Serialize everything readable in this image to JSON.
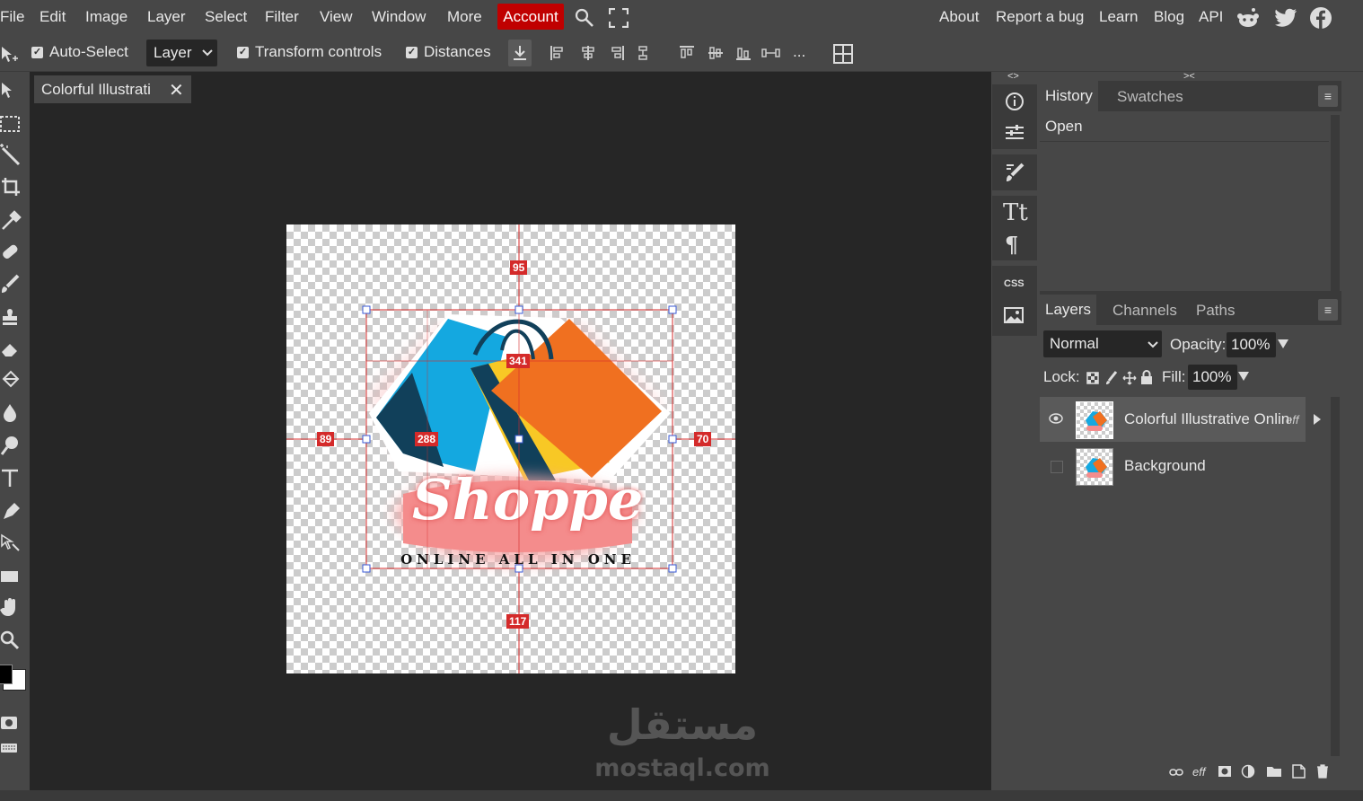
{
  "menu": {
    "items": [
      "File",
      "Edit",
      "Image",
      "Layer",
      "Select",
      "Filter",
      "View",
      "Window",
      "More"
    ],
    "account": "Account",
    "right_links": [
      "About",
      "Report a bug",
      "Learn",
      "Blog",
      "API"
    ]
  },
  "options": {
    "auto_select": "Auto-Select",
    "layer_select": "Layer",
    "transform_controls": "Transform controls",
    "distances": "Distances",
    "more": "..."
  },
  "document": {
    "tab_title": "Colorful Illustrati",
    "distance_top": "95",
    "distance_bottom": "117",
    "distance_left": "89",
    "distance_right": "70",
    "box_width": "288",
    "box_height": "341",
    "logo_title": "Shoppe",
    "logo_subtitle": "ONLINE ALL IN ONE"
  },
  "history_panel": {
    "tabs": [
      "History",
      "Swatches"
    ],
    "items": [
      "Open"
    ]
  },
  "layers_panel": {
    "tabs": [
      "Layers",
      "Channels",
      "Paths"
    ],
    "blend_mode": "Normal",
    "opacity_label": "Opacity:",
    "opacity_value": "100%",
    "lock_label": "Lock:",
    "fill_label": "Fill:",
    "fill_value": "100%",
    "layers": [
      {
        "name": "Colorful Illustrative Online",
        "badge": "eff",
        "visible": true
      },
      {
        "name": "Background",
        "visible": false
      }
    ],
    "footer_eff": "eff"
  },
  "strip": {
    "css_label": "CSS"
  },
  "watermark": {
    "arabic": "مستقل",
    "latin": "mostaql.com"
  },
  "colors": {
    "accent": "#c00000",
    "guide": "#d42a2a",
    "panel": "#474747",
    "workspace": "#262626"
  }
}
